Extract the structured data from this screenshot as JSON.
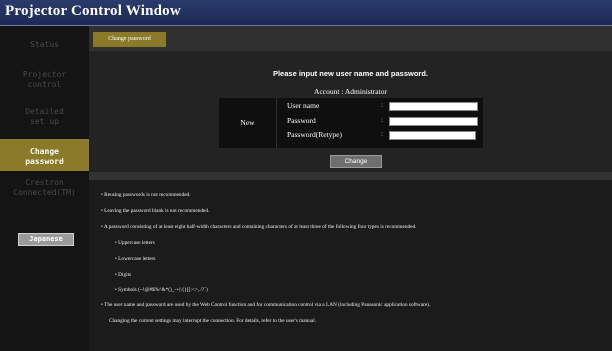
{
  "window": {
    "title": "Projector Control Window"
  },
  "sidebar": {
    "items": [
      {
        "label": "Status",
        "active": false
      },
      {
        "label": "Projector control",
        "active": false
      },
      {
        "label": "Detailed set up",
        "active": false
      },
      {
        "label": "Change password",
        "active": true
      },
      {
        "label": "Crestron Connected(TM)",
        "active": false
      }
    ],
    "language_button": "Japanese"
  },
  "toolbar": {
    "tab_label": "Change password"
  },
  "form": {
    "heading": "Please input new user name and password.",
    "account_line": "Account : Administrator",
    "group_label": "New",
    "fields": [
      {
        "label": "User name",
        "value": ""
      },
      {
        "label": "Password",
        "value": ""
      },
      {
        "label": "Password(Retype)",
        "value": ""
      }
    ],
    "colon": ":",
    "submit_label": "Change"
  },
  "notes": [
    "•  Reusing passwords is not recommended.",
    "•  Leaving the password blank is not recommended.",
    "•  A password consisting of at least eight half-width characters and containing characters of at least three of the following four types is recommended.",
    "•  Uppercase letters",
    "•  Lowercase letters",
    "•  Digits",
    "•  Symbols (~!@#$%^&*()_-+|\\{}[]:<>,./?`)",
    "•  The user name and password are used by the Web Control function and for communication control via a LAN (including Panasonic application software).",
    "Changing the current settings may interrupt the connection. For details, refer to the user's manual."
  ],
  "colors": {
    "accent": "#8a7a2a",
    "title_bar": "#1c2a55",
    "background": "#1a1a1a"
  }
}
